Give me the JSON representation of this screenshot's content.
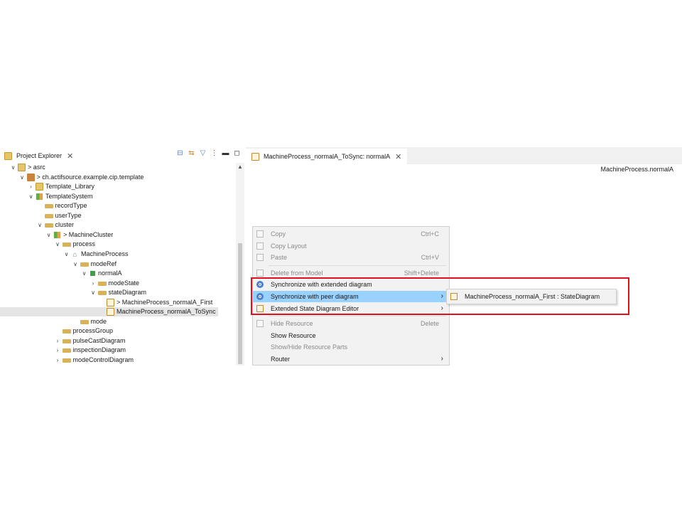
{
  "explorer": {
    "tab_title": "Project Explorer",
    "close_glyph": "✕"
  },
  "tree": [
    {
      "label": "asrc",
      "twisty": "v",
      "icon": "folder",
      "prefix": "> ",
      "depth": 0
    },
    {
      "label": "ch.actifsource.example.cip.template",
      "twisty": "v",
      "icon": "package",
      "prefix": "> ",
      "depth": 1
    },
    {
      "label": "Template_Library",
      "twisty": ">",
      "icon": "folder",
      "prefix": "",
      "depth": 2
    },
    {
      "label": "TemplateSystem",
      "twisty": "v",
      "icon": "system",
      "prefix": "",
      "depth": 2
    },
    {
      "label": "recordType",
      "twisty": "",
      "icon": "ref",
      "prefix": "",
      "depth": 3
    },
    {
      "label": "userType",
      "twisty": "",
      "icon": "ref",
      "prefix": "",
      "depth": 3
    },
    {
      "label": "cluster",
      "twisty": "v",
      "icon": "ref",
      "prefix": "",
      "depth": 3
    },
    {
      "label": "MachineCluster",
      "twisty": "v",
      "icon": "system",
      "prefix": "> ",
      "depth": 4
    },
    {
      "label": "process",
      "twisty": "v",
      "icon": "ref",
      "prefix": "",
      "depth": 5
    },
    {
      "label": "MachineProcess",
      "twisty": "v",
      "icon": "tree",
      "prefix": "",
      "depth": 6
    },
    {
      "label": "modeRef",
      "twisty": "v",
      "icon": "ref",
      "prefix": "",
      "depth": 7
    },
    {
      "label": "normalA",
      "twisty": "v",
      "icon": "state",
      "prefix": "",
      "depth": 8
    },
    {
      "label": "modeState",
      "twisty": ">",
      "icon": "ref",
      "prefix": "",
      "depth": 9
    },
    {
      "label": "stateDiagram",
      "twisty": "v",
      "icon": "ref",
      "prefix": "",
      "depth": 9
    },
    {
      "label": "MachineProcess_normalA_First",
      "twisty": "",
      "icon": "diagram",
      "prefix": "> ",
      "depth": 10
    },
    {
      "label": "MachineProcess_normalA_ToSync",
      "twisty": "",
      "icon": "diagram",
      "prefix": "",
      "depth": 10,
      "selected": true
    },
    {
      "label": "mode",
      "twisty": "",
      "icon": "ref",
      "prefix": "",
      "depth": 7
    },
    {
      "label": "processGroup",
      "twisty": "",
      "icon": "ref",
      "prefix": "",
      "depth": 5
    },
    {
      "label": "pulseCastDiagram",
      "twisty": ">",
      "icon": "ref",
      "prefix": "",
      "depth": 5
    },
    {
      "label": "inspectionDiagram",
      "twisty": ">",
      "icon": "ref",
      "prefix": "",
      "depth": 5
    },
    {
      "label": "modeControlDiagram",
      "twisty": ">",
      "icon": "ref",
      "prefix": "",
      "depth": 5
    }
  ],
  "editor": {
    "tab_title": "MachineProcess_normalA_ToSync: normalA",
    "close_glyph": "✕",
    "breadcrumb": "MachineProcess.normalA"
  },
  "context_menu": [
    {
      "label": "Copy",
      "accel": "Ctrl+C",
      "disabled": true,
      "icon": "copy-icon"
    },
    {
      "label": "Copy Layout",
      "accel": "",
      "disabled": true,
      "icon": "copy-layout-icon"
    },
    {
      "label": "Paste",
      "accel": "Ctrl+V",
      "disabled": true,
      "icon": "paste-icon"
    },
    {
      "separator": true
    },
    {
      "label": "Delete from Model",
      "accel": "Shift+Delete",
      "disabled": true,
      "icon": "delete-icon"
    },
    {
      "label": "Synchronize with extended diagram",
      "accel": "",
      "disabled": false,
      "icon": "sync-icon"
    },
    {
      "label": "Synchronize with peer diagram",
      "accel": "",
      "disabled": false,
      "highlighted": true,
      "submenu": true,
      "icon": "sync-icon"
    },
    {
      "label": "Extended State Diagram Editor",
      "accel": "",
      "disabled": false,
      "submenu": true,
      "icon": "state-diagram-icon"
    },
    {
      "separator": true
    },
    {
      "label": "Hide Resource",
      "accel": "Delete",
      "disabled": true,
      "icon": "hide-icon"
    },
    {
      "label": "Show Resource",
      "accel": "",
      "disabled": false,
      "icon": ""
    },
    {
      "label": "Show/Hide Resource Parts",
      "accel": "",
      "disabled": true,
      "icon": ""
    },
    {
      "label": "Router",
      "accel": "",
      "disabled": false,
      "submenu": true,
      "icon": ""
    }
  ],
  "submenu": {
    "item_label": "MachineProcess_normalA_First : StateDiagram"
  },
  "colors": {
    "highlight": "#99d1ff",
    "red_box": "#e0101c",
    "selection": "#e5e5e5"
  }
}
